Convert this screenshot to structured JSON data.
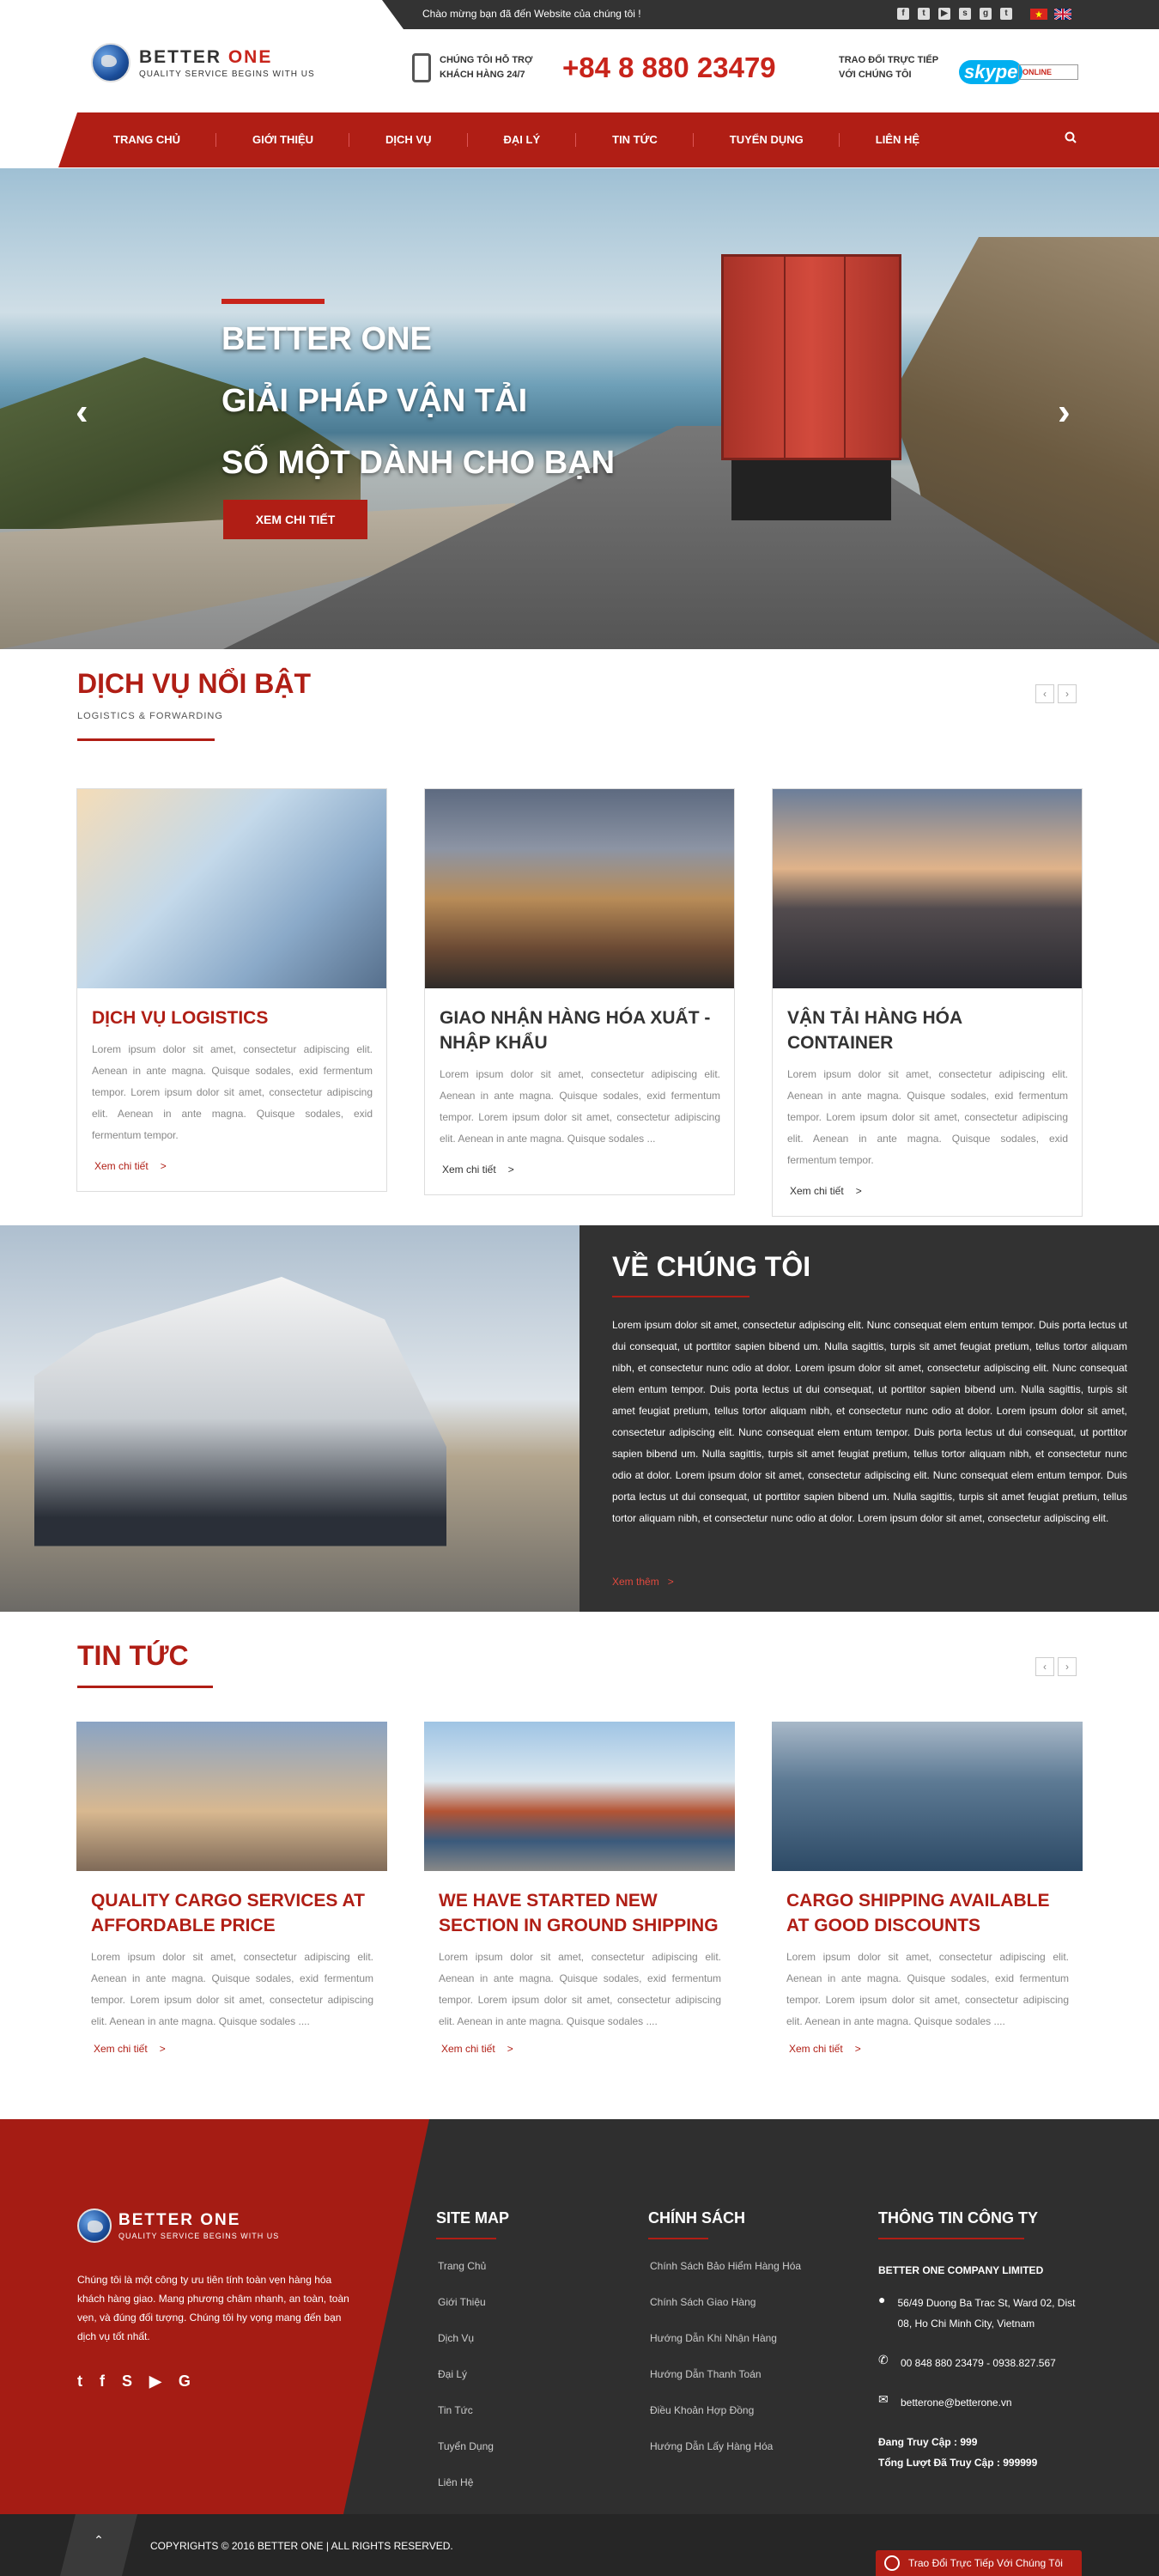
{
  "topbar": {
    "welcome": "Chào mừng bạn đã đến Website của chúng tôi !",
    "social_icons": [
      "facebook-icon",
      "twitter-icon",
      "youtube-icon",
      "skype-icon",
      "google-plus-icon",
      "tumblr-icon"
    ],
    "languages": [
      "vietnamese-flag",
      "english-flag"
    ]
  },
  "header": {
    "logo_title_1": "BETTER",
    "logo_title_2": "ONE",
    "logo_sub": "QUALITY SERVICE BEGINS WITH US",
    "support_line1": "CHÚNG TÔI HỖ TRỢ",
    "support_line2": "KHÁCH HÀNG 24/7",
    "hotline": "+84 8 880 23479",
    "trao_line1": "TRAO ĐỔI TRỰC TIẾP",
    "trao_line2": "VỚI CHÚNG TÔI",
    "skype_label": "skype",
    "online_label": "ONLINE"
  },
  "nav": {
    "items": [
      "TRANG CHỦ",
      "GIỚI THIỆU",
      "DỊCH VỤ",
      "ĐẠI LÝ",
      "TIN TỨC",
      "TUYỂN DỤNG",
      "LIÊN HỆ"
    ]
  },
  "hero": {
    "line1": "BETTER ONE",
    "line2": "GIẢI PHÁP VẬN TẢI",
    "line3": "SỐ MỘT DÀNH CHO BẠN",
    "button": "XEM CHI TIẾT",
    "prev": "‹",
    "next": "›"
  },
  "services": {
    "title": "DỊCH VỤ NỔI BẬT",
    "subtitle": "LOGISTICS & FORWARDING",
    "pager_prev": "‹",
    "pager_next": "›",
    "cards": [
      {
        "title": "DỊCH VỤ LOGISTICS",
        "text": "Lorem ipsum dolor sit amet, consectetur adipiscing elit. Aenean in ante magna. Quisque sodales, exid fermentum tempor. Lorem ipsum dolor sit amet, consectetur adipiscing elit. Aenean in ante magna. Quisque sodales, exid fermentum tempor.",
        "more": "Xem chi tiết",
        "color": "#b01e15"
      },
      {
        "title": "GIAO NHẬN HÀNG HÓA XUẤT - NHẬP KHẨU",
        "text": "Lorem ipsum dolor sit amet, consectetur adipiscing elit. Aenean in ante magna. Quisque sodales, exid fermentum tempor. Lorem ipsum dolor sit amet, consectetur adipiscing elit. Aenean in ante magna. Quisque sodales ...",
        "more": "Xem chi tiết",
        "color": "#333333"
      },
      {
        "title": "VẬN TẢI HÀNG HÓA CONTAINER",
        "text": "Lorem ipsum dolor sit amet, consectetur adipiscing elit. Aenean in ante magna. Quisque sodales, exid fermentum tempor. Lorem ipsum dolor sit amet, consectetur adipiscing elit. Aenean in ante magna. Quisque sodales, exid fermentum tempor.",
        "more": "Xem chi tiết",
        "color": "#333333"
      }
    ]
  },
  "about": {
    "title": "VỀ CHÚNG TÔI",
    "text": "Lorem ipsum dolor sit amet, consectetur adipiscing elit. Nunc consequat elem entum tempor. Duis porta lectus ut dui consequat, ut porttitor sapien bibend um. Nulla sagittis, turpis sit amet feugiat pretium, tellus tortor aliquam nibh, et consectetur nunc odio at dolor. Lorem ipsum dolor sit amet, consectetur adipiscing elit. Nunc consequat elem entum tempor. Duis porta lectus ut dui consequat, ut porttitor sapien bibend um. Nulla sagittis, turpis sit amet feugiat pretium, tellus tortor aliquam nibh, et consectetur nunc odio at dolor. Lorem ipsum dolor sit amet, consectetur adipiscing elit. Nunc consequat elem entum tempor. Duis porta lectus ut dui consequat, ut porttitor sapien bibend um. Nulla sagittis, turpis sit amet feugiat pretium, tellus tortor aliquam nibh, et consectetur nunc odio at dolor. Lorem ipsum dolor sit amet, consectetur adipiscing elit. Nunc consequat elem entum tempor. Duis porta lectus ut dui consequat, ut porttitor sapien bibend um. Nulla sagittis, turpis sit amet feugiat pretium, tellus tortor aliquam nibh, et consectetur nunc odio at dolor. Lorem ipsum dolor sit amet, consectetur adipiscing elit.",
    "more": "Xem thêm"
  },
  "news": {
    "title": "TIN TỨC",
    "pager_prev": "‹",
    "pager_next": "›",
    "cards": [
      {
        "title": "QUALITY CARGO SERVICES AT AFFORDABLE PRICE",
        "text": "Lorem ipsum dolor sit amet, consectetur adipiscing elit. Aenean in ante magna. Quisque sodales, exid fermentum tempor. Lorem ipsum dolor sit amet, consectetur adipiscing elit. Aenean in ante magna. Quisque sodales ....",
        "more": "Xem chi tiết"
      },
      {
        "title": "WE HAVE STARTED NEW SECTION IN GROUND SHIPPING",
        "text": "Lorem ipsum dolor sit amet, consectetur adipiscing elit. Aenean in ante magna. Quisque sodales, exid fermentum tempor. Lorem ipsum dolor sit amet, consectetur adipiscing elit. Aenean in ante magna. Quisque sodales ....",
        "more": "Xem chi tiết"
      },
      {
        "title": "CARGO SHIPPING AVAILABLE AT GOOD DISCOUNTS",
        "text": "Lorem ipsum dolor sit amet, consectetur adipiscing elit. Aenean in ante magna. Quisque sodales, exid fermentum tempor. Lorem ipsum dolor sit amet, consectetur adipiscing elit. Aenean in ante magna. Quisque sodales ....",
        "more": "Xem chi tiết"
      }
    ]
  },
  "footer": {
    "logo_title_1": "BETTER",
    "logo_title_2": "ONE",
    "logo_sub": "QUALITY SERVICE BEGINS WITH US",
    "description": "Chúng tôi là một công ty ưu tiên tính toàn vẹn hàng hóa khách hàng giao. Mang phương châm nhanh, an toàn, toàn vẹn, và đúng đối tượng. Chúng tôi hy vọng mang đến bạn dịch vụ tốt nhất.",
    "social_icons": [
      "twitter-icon",
      "facebook-icon",
      "skype-icon",
      "youtube-icon",
      "google-icon"
    ],
    "sitemap_title": "SITE MAP",
    "sitemap": [
      "Trang Chủ",
      "Giới Thiệu",
      "Dịch Vụ",
      "Đại Lý",
      "Tin Tức",
      "Tuyển Dụng",
      "Liên Hệ"
    ],
    "policy_title": "CHÍNH SÁCH",
    "policy": [
      "Chính Sách Bảo Hiểm Hàng Hóa",
      "Chính Sách Giao Hàng",
      "Hướng Dẫn Khi Nhận Hàng",
      "Hướng Dẫn Thanh Toán",
      "Điều Khoản Hợp Đồng",
      "Hướng Dẫn Lấy Hàng Hóa"
    ],
    "info_title": "THÔNG TIN CÔNG TY",
    "company": "BETTER ONE COMPANY LIMITED",
    "address": "56/49 Duong Ba Trac St, Ward 02, Dist 08, Ho Chi Minh City, Vietnam",
    "phone": "00 848 880 23479  -  0938.827.567",
    "email": "betterone@betterone.vn",
    "online_now": "Đang Truy Cập : 999",
    "total_visits": "Tổng Lượt Đã Truy Cập : 999999",
    "copyright": "COPYRIGHTS © 2016 BETTER ONE | ALL RIGHTS RESERVED.",
    "chat": "Trao Đổi Trực Tiếp Với Chúng Tôi",
    "totop": "⌃"
  },
  "colors": {
    "brand_red": "#b01e15",
    "dark": "#323232"
  }
}
